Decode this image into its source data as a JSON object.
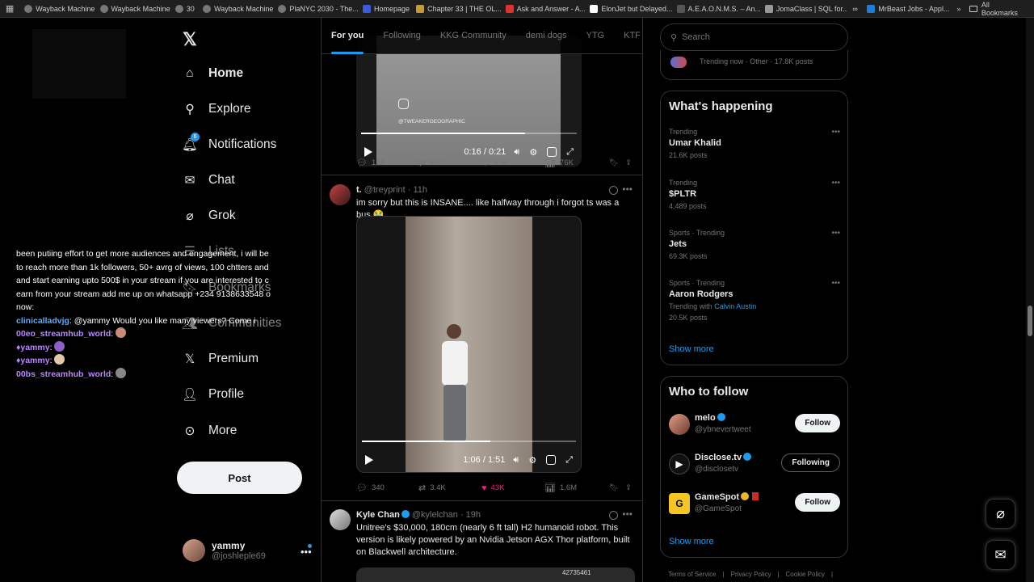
{
  "bookmarks": [
    {
      "label": "Wayback Machine"
    },
    {
      "label": "Wayback Machine"
    },
    {
      "label": "30"
    },
    {
      "label": "Wayback Machine"
    },
    {
      "label": "PlaNYC 2030 - The..."
    },
    {
      "label": "Homepage"
    },
    {
      "label": "Chapter 33 | THE OL..."
    },
    {
      "label": "Ask and Answer - A..."
    },
    {
      "label": "ElonJet but Delayed..."
    },
    {
      "label": "A.E.A.O.N.M.S. – An..."
    },
    {
      "label": "JomaClass | SQL for..."
    },
    {
      "label": ""
    },
    {
      "label": "MrBeast Jobs - Appl..."
    }
  ],
  "all_bookmarks": "All Bookmarks",
  "overlay_chat": {
    "promo": "been putiing effort to get more audiences and engagement, i will be to reach more than 1k followers, 50+ avrg of views, 100 chtters and and start earning upto 500$ in your stream if you are interested to c earn from your stream add me up on whatsapp +234 9138633548 o now:",
    "lines": [
      {
        "name": "clinicalladvjg",
        "text": " @yammy Would you like many viewers? Come i"
      },
      {
        "name": "00eo_streamhub_world",
        "text": ""
      },
      {
        "name": "yammy",
        "text": ""
      },
      {
        "name": "yammy",
        "text": ""
      },
      {
        "name": "00bs_streamhub_world",
        "text": ""
      }
    ]
  },
  "nav": {
    "items": [
      {
        "label": "Home"
      },
      {
        "label": "Explore"
      },
      {
        "label": "Notifications",
        "badge": "6"
      },
      {
        "label": "Chat"
      },
      {
        "label": "Grok"
      },
      {
        "label": "Lists"
      },
      {
        "label": "Bookmarks"
      },
      {
        "label": "Communities"
      },
      {
        "label": "Premium"
      },
      {
        "label": "Profile"
      },
      {
        "label": "More"
      }
    ],
    "post_label": "Post",
    "account": {
      "name": "yammy",
      "handle": "@joshleple69"
    }
  },
  "feed": {
    "tabs": [
      "For you",
      "Following",
      "KKG Community",
      "demi dogs",
      "YTG",
      "KTF"
    ],
    "tweet1": {
      "video_watermark": "@TWEAKERGEOGRAPHIC",
      "video_time": "0:16 / 0:21",
      "progress": 0.76,
      "replies": "124",
      "reposts": "570",
      "likes": "3.9K",
      "views": "76K"
    },
    "tweet2": {
      "name": "t.",
      "handle": "@treyprint",
      "time": "· 11h",
      "text": "im sorry but this is INSANE.... like halfway through i forgot ts was a bus 😭",
      "video_time": "1:06 / 1:51",
      "progress": 0.6,
      "replies": "340",
      "reposts": "3.4K",
      "likes": "43K",
      "views": "1.6M"
    },
    "tweet3": {
      "name": "Kyle Chan",
      "handle": "@kylelchan",
      "time": "· 19h",
      "text": "Unitree's $30,000, 180cm (nearly 6 ft tall) H2 humanoid robot. This version is likely powered by an Nvidia Jetson AGX Thor platform, built on Blackwell architecture.",
      "video_label": "42735461"
    }
  },
  "right": {
    "search_placeholder": "Search",
    "top_trend": "Trending now · Other · 17.8K posts",
    "whats_happening_title": "What's happening",
    "trends": [
      {
        "meta": "Trending",
        "topic": "Umar Khalid",
        "posts": "21.6K posts"
      },
      {
        "meta": "Trending",
        "topic": "$PLTR",
        "posts": "4,489 posts"
      },
      {
        "meta": "Sports · Trending",
        "topic": "Jets",
        "posts": "69.3K posts"
      },
      {
        "meta": "Sports · Trending",
        "topic": "Aaron Rodgers",
        "extra_prefix": "Trending with",
        "extra_link": "Calvin Austin",
        "posts": "20.5K posts"
      }
    ],
    "show_more": "Show more",
    "who_to_follow_title": "Who to follow",
    "follows": [
      {
        "name": "melo",
        "handle": "@ybnevertweet",
        "button": "Follow"
      },
      {
        "name": "Disclose.tv",
        "handle": "@disclosetv",
        "button": "Following"
      },
      {
        "name": "GameSpot",
        "handle": "@GameSpot",
        "button": "Follow"
      }
    ],
    "footer": [
      "Terms of Service",
      "|",
      "Privacy Policy",
      "|",
      "Cookie Policy",
      "|"
    ]
  }
}
